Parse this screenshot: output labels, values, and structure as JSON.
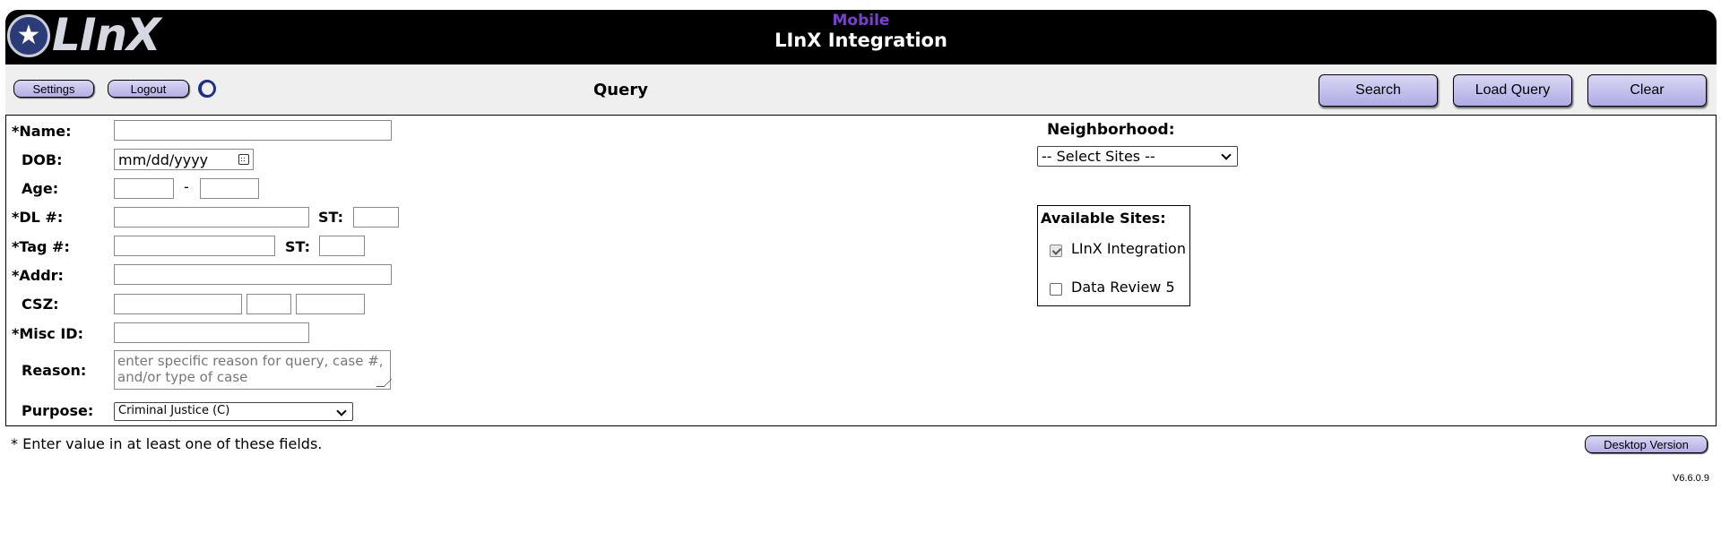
{
  "header": {
    "logo_text": "LInX",
    "subtitle": "Mobile",
    "title": "LInX Integration"
  },
  "toolbar": {
    "settings_label": "Settings",
    "logout_label": "Logout",
    "title": "Query",
    "search_label": "Search",
    "load_query_label": "Load Query",
    "clear_label": "Clear"
  },
  "form": {
    "name_label": "*Name:",
    "dob_label": "DOB:",
    "dob_placeholder": "mm/dd/yyyy",
    "age_label": "Age:",
    "age_separator": "-",
    "dl_label": "*DL #:",
    "st_label": "ST:",
    "tag_label": "*Tag #:",
    "tag_st_label": "ST:",
    "addr_label": "*Addr:",
    "csz_label": "CSZ:",
    "misc_label": "*Misc ID:",
    "reason_label": "Reason:",
    "reason_placeholder": "enter specific reason for query, case #, and/or type of case",
    "purpose_label": "Purpose:",
    "purpose_value": "Criminal Justice (C)"
  },
  "sites": {
    "neighborhood_label": "Neighborhood:",
    "neighborhood_value": "-- Select Sites --",
    "available_label": "Available Sites:",
    "items": [
      {
        "label": "LInX Integration",
        "checked": true
      },
      {
        "label": "Data Review 5",
        "checked": false
      }
    ]
  },
  "footer": {
    "note": "* Enter value in at least one of these fields.",
    "desktop_label": "Desktop Version",
    "version": "V6.6.0.9"
  },
  "colors": {
    "header_bg": "#000000",
    "subtitle": "#7b3fd6",
    "button_bg": "#b3aee6"
  }
}
